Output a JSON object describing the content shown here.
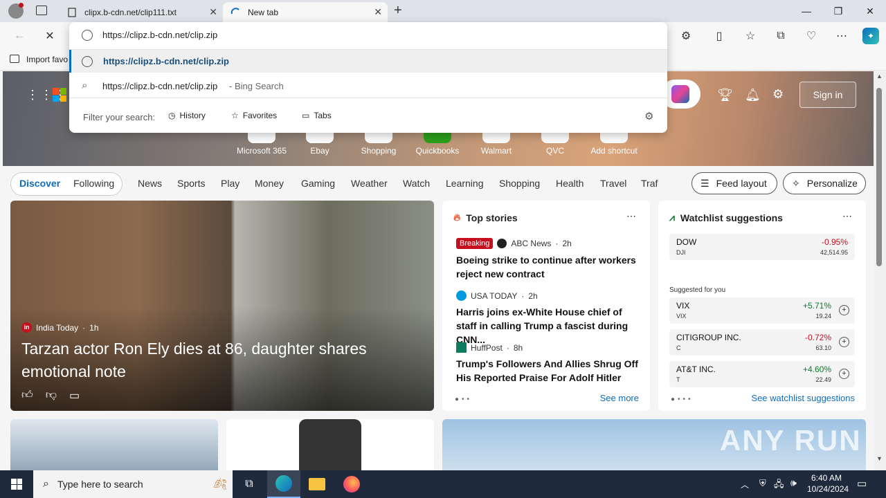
{
  "browser": {
    "tabs": [
      {
        "title": "clipx.b-cdn.net/clip111.txt"
      },
      {
        "title": "New tab"
      }
    ],
    "address": {
      "value": "https://clipz.b-cdn.net/clip.zip"
    },
    "favorites_bar": {
      "import_label": "Import favo"
    }
  },
  "omnibox": {
    "suggestions": [
      {
        "text": "https://clipz.b-cdn.net/clip.zip",
        "suffix": ""
      },
      {
        "text": "https://clipz.b-cdn.net/clip.zip",
        "suffix": " - Bing Search"
      }
    ],
    "filter_label": "Filter your search:",
    "filters": [
      "History",
      "Favorites",
      "Tabs"
    ]
  },
  "newtab": {
    "sign_in": "Sign in",
    "shortcuts": [
      "Microsoft 365",
      "Ebay",
      "Shopping",
      "Quickbooks",
      "Walmart",
      "QVC",
      "Add shortcut"
    ],
    "feed_tabs": {
      "active": "Discover",
      "other": "Following"
    },
    "categories": [
      "News",
      "Sports",
      "Play",
      "Money",
      "Gaming",
      "Weather",
      "Watch",
      "Learning",
      "Shopping",
      "Health",
      "Travel",
      "Traf"
    ],
    "feed_layout": "Feed layout",
    "personalize": "Personalize",
    "hero_story": {
      "source": "India Today",
      "age": "1h",
      "headline": "Tarzan actor Ron Ely dies at 86, daughter shares emotional note"
    },
    "top_stories": {
      "title": "Top stories",
      "breaking": "Breaking",
      "items": [
        {
          "source": "ABC News",
          "age": "2h",
          "headline": "Boeing strike to continue after workers reject new contract"
        },
        {
          "source": "USA TODAY",
          "age": "2h",
          "headline": "Harris joins ex-White House chief of staff in calling Trump a fascist during CNN..."
        },
        {
          "source": "HuffPost",
          "age": "8h",
          "headline": "Trump's Followers And Allies Shrug Off His Reported Praise For Adolf Hitler"
        }
      ],
      "see_more": "See more"
    },
    "watchlist": {
      "title": "Watchlist suggestions",
      "dow": {
        "name": "DOW",
        "ticker": "DJI",
        "change": "-0.95%",
        "price": "42,514.95"
      },
      "suggested_label": "Suggested for you",
      "items": [
        {
          "name": "VIX",
          "ticker": "VIX",
          "change": "+5.71%",
          "price": "19.24",
          "color": "#0b7a2a"
        },
        {
          "name": "CITIGROUP INC.",
          "ticker": "C",
          "change": "-0.72%",
          "price": "63.10",
          "color": "#c50f1f"
        },
        {
          "name": "AT&T INC.",
          "ticker": "T",
          "change": "+4.60%",
          "price": "22.49",
          "color": "#0b7a2a"
        }
      ],
      "see_all": "See watchlist suggestions"
    }
  },
  "taskbar": {
    "search_placeholder": "Type here to search",
    "time": "6:40 AM",
    "date": "10/24/2024"
  },
  "watermark": "ANY RUN",
  "colors": {
    "accent": "#0f6cbd",
    "negative": "#c50f1f",
    "positive": "#0b7a2a",
    "breaking": "#c50f1f"
  }
}
